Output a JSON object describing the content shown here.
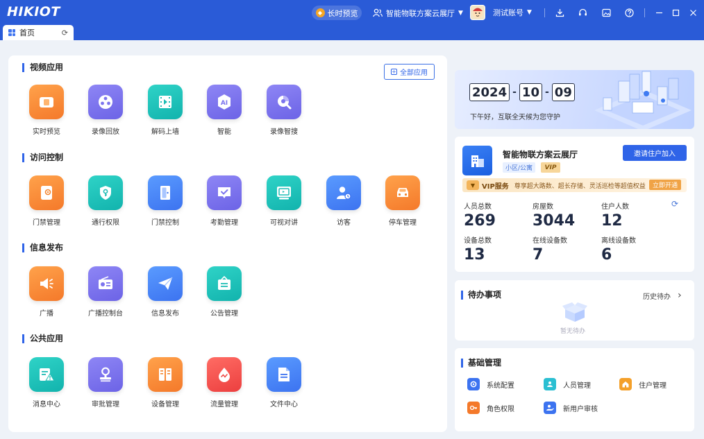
{
  "app": {
    "logo": "HIKIOT"
  },
  "topbar": {
    "preview_label": "长时预览",
    "project_label": "智能物联方案云展厅",
    "account_label": "测试账号"
  },
  "tabs": [
    {
      "label": "首页"
    }
  ],
  "main": {
    "all_apps_label": "全部应用",
    "sections": [
      {
        "title": "视频应用",
        "apps": [
          {
            "label": "实时预览",
            "icon": "live-view-icon",
            "color": "orange"
          },
          {
            "label": "录像回放",
            "icon": "film-reel-icon",
            "color": "purple"
          },
          {
            "label": "解码上墙",
            "icon": "video-wall-icon",
            "color": "teal"
          },
          {
            "label": "智能",
            "icon": "ai-icon",
            "color": "purple"
          },
          {
            "label": "录像智搜",
            "icon": "smart-search-icon",
            "color": "purple"
          }
        ]
      },
      {
        "title": "访问控制",
        "apps": [
          {
            "label": "门禁管理",
            "icon": "access-card-icon",
            "color": "orange"
          },
          {
            "label": "通行权限",
            "icon": "key-shield-icon",
            "color": "teal"
          },
          {
            "label": "门禁控制",
            "icon": "door-icon",
            "color": "blue"
          },
          {
            "label": "考勤管理",
            "icon": "attendance-icon",
            "color": "purple"
          },
          {
            "label": "可视对讲",
            "icon": "intercom-icon",
            "color": "teal"
          },
          {
            "label": "访客",
            "icon": "visitor-icon",
            "color": "blue"
          },
          {
            "label": "停车管理",
            "icon": "car-icon",
            "color": "orange"
          }
        ]
      },
      {
        "title": "信息发布",
        "apps": [
          {
            "label": "广播",
            "icon": "megaphone-icon",
            "color": "orange"
          },
          {
            "label": "广播控制台",
            "icon": "radio-icon",
            "color": "purple"
          },
          {
            "label": "信息发布",
            "icon": "paper-plane-icon",
            "color": "blue"
          },
          {
            "label": "公告管理",
            "icon": "notice-board-icon",
            "color": "teal"
          }
        ]
      },
      {
        "title": "公共应用",
        "apps": [
          {
            "label": "消息中心",
            "icon": "alert-message-icon",
            "color": "teal"
          },
          {
            "label": "审批管理",
            "icon": "stamp-icon",
            "color": "purple"
          },
          {
            "label": "设备管理",
            "icon": "cabinet-icon",
            "color": "orange"
          },
          {
            "label": "流量管理",
            "icon": "flow-drop-icon",
            "color": "red"
          },
          {
            "label": "文件中心",
            "icon": "file-icon",
            "color": "blue"
          }
        ]
      }
    ]
  },
  "date_card": {
    "year": "2024",
    "month": "10",
    "day": "09",
    "greeting": "下午好，互联全天候为您守护"
  },
  "community": {
    "name": "智能物联方案云展厅",
    "tag": "小区/公寓",
    "vip_badge": "VIP",
    "invite_button": "邀请住户加入",
    "vip_service": {
      "title": "VIP服务",
      "desc": "尊享超大路数、超长存储、灵活巡检等超值权益",
      "button": "立即开通"
    },
    "stats": [
      {
        "label": "人员总数",
        "value": "269"
      },
      {
        "label": "房屋数",
        "value": "3044"
      },
      {
        "label": "住户人数",
        "value": "12"
      },
      {
        "label": "设备总数",
        "value": "13"
      },
      {
        "label": "在线设备数",
        "value": "7"
      },
      {
        "label": "离线设备数",
        "value": "6"
      }
    ]
  },
  "todo": {
    "title": "待办事项",
    "history_label": "历史待办",
    "empty_label": "暂无待办"
  },
  "basic": {
    "title": "基础管理",
    "items": [
      {
        "label": "系统配置",
        "icon": "gear-icon",
        "color": "#3c73f0"
      },
      {
        "label": "人员管理",
        "icon": "person-card-icon",
        "color": "#2bbfd2"
      },
      {
        "label": "住户管理",
        "icon": "house-edit-icon",
        "color": "#f4a02a"
      },
      {
        "label": "角色权限",
        "icon": "role-key-icon",
        "color": "#f4792a"
      },
      {
        "label": "新用户审核",
        "icon": "user-check-icon",
        "color": "#3c73f0"
      }
    ]
  },
  "colors": {
    "brand": "#2a5bd7",
    "accent": "#2f64e8"
  }
}
